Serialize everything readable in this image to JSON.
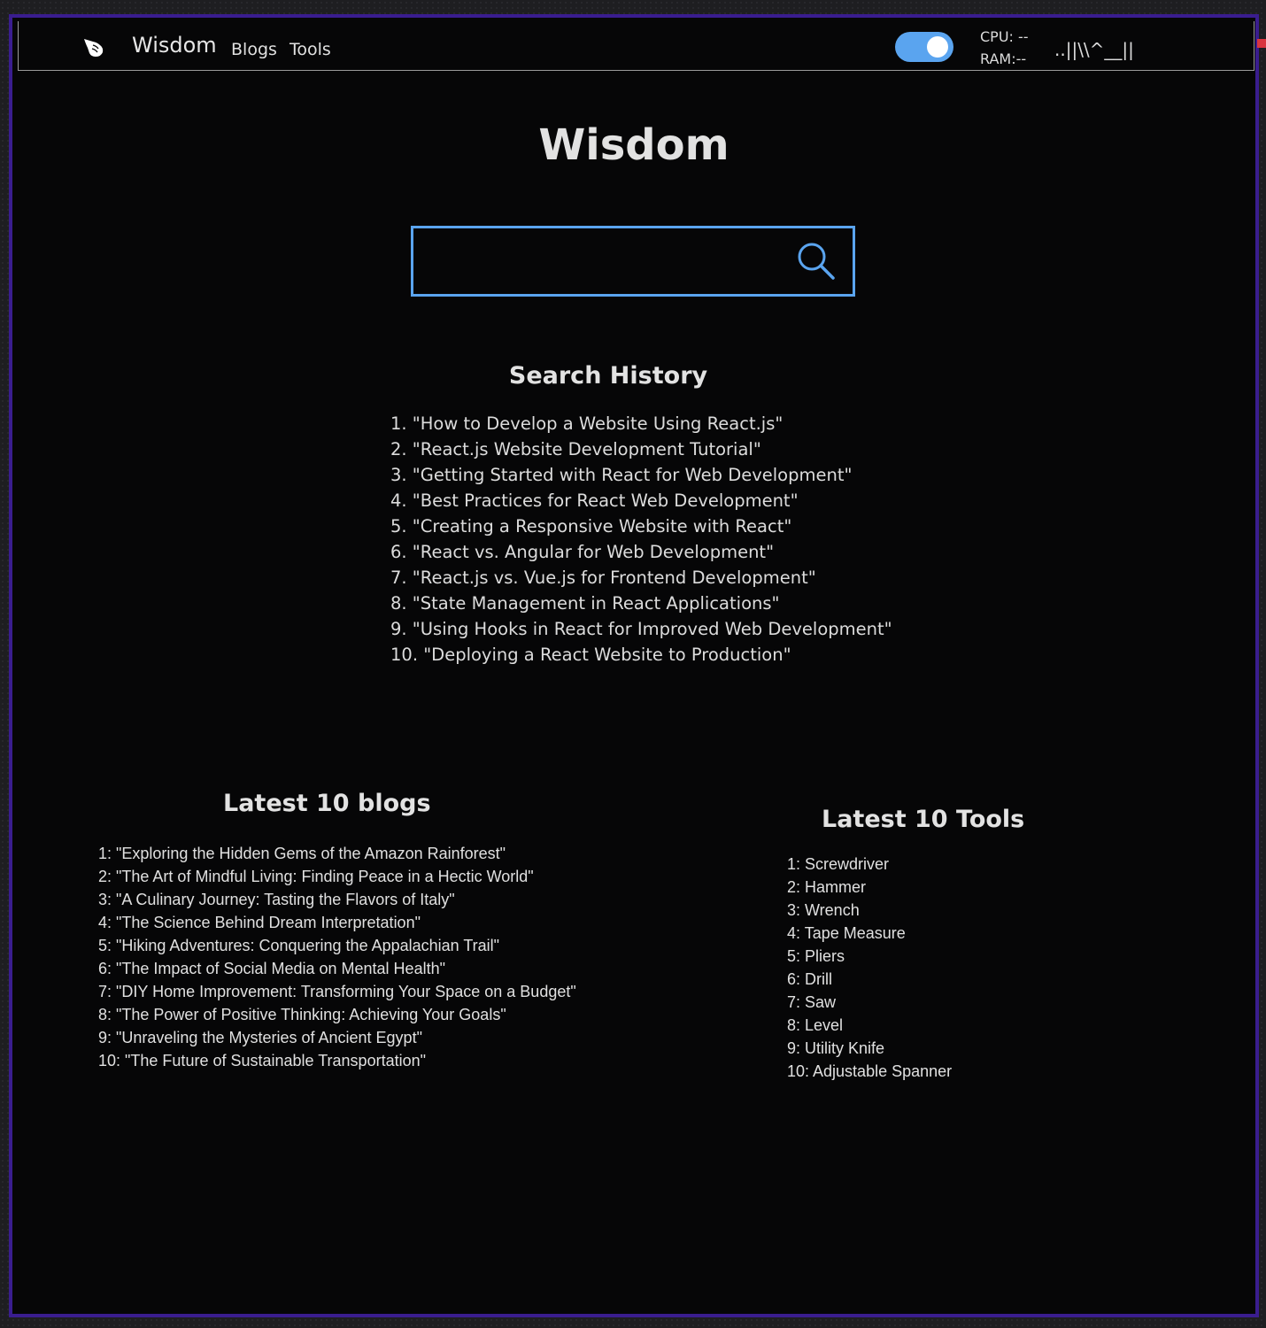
{
  "navbar": {
    "logo_icon": "pointing-hand-icon",
    "brand": "Wisdom",
    "links": [
      "Blogs",
      "Tools"
    ],
    "theme_toggle": {
      "state": "on",
      "color": "#5aa4ef"
    },
    "cpu_label": "CPU: --",
    "ram_label": "RAM:--",
    "glyph_text": "..||\\\\^__||"
  },
  "main": {
    "title": "Wisdom",
    "search": {
      "placeholder": "",
      "value": "",
      "icon": "search-icon",
      "border_color": "#5aa4ef"
    }
  },
  "search_history": {
    "title": "Search History",
    "items": [
      "1. \"How to Develop a Website Using React.js\"",
      "2. \"React.js Website Development Tutorial\"",
      "3. \"Getting Started with React for Web Development\"",
      "4. \"Best Practices for React Web Development\"",
      "5. \"Creating a Responsive Website with React\"",
      "6. \"React vs. Angular for Web Development\"",
      "7. \"React.js vs. Vue.js for Frontend Development\"",
      "8. \"State Management in React Applications\"",
      "9. \"Using Hooks in React for Improved Web Development\"",
      "10. \"Deploying a React Website to Production\""
    ]
  },
  "blogs": {
    "title": "Latest 10 blogs",
    "items": [
      "1: \"Exploring the Hidden Gems of the Amazon Rainforest\"",
      "2: \"The Art of Mindful Living: Finding Peace in a Hectic World\"",
      "3: \"A Culinary Journey: Tasting the Flavors of Italy\"",
      "4: \"The Science Behind Dream Interpretation\"",
      "5: \"Hiking Adventures: Conquering the Appalachian Trail\"",
      "6: \"The Impact of Social Media on Mental Health\"",
      "7: \"DIY Home Improvement: Transforming Your Space on a Budget\"",
      "8: \"The Power of Positive Thinking: Achieving Your Goals\"",
      "9: \"Unraveling the Mysteries of Ancient Egypt\"",
      "10: \"The Future of Sustainable Transportation\""
    ]
  },
  "tools": {
    "title": "Latest 10 Tools",
    "items": [
      "1: Screwdriver",
      "2: Hammer",
      "3: Wrench",
      "4: Tape Measure",
      "5: Pliers",
      "6: Drill",
      "7: Saw",
      "8: Level",
      "9: Utility Knife",
      "10: Adjustable Spanner"
    ]
  },
  "colors": {
    "frame_border": "#3a1d8f",
    "page_background": "#060607",
    "text": "#e0e0e0",
    "accent": "#5aa4ef"
  }
}
